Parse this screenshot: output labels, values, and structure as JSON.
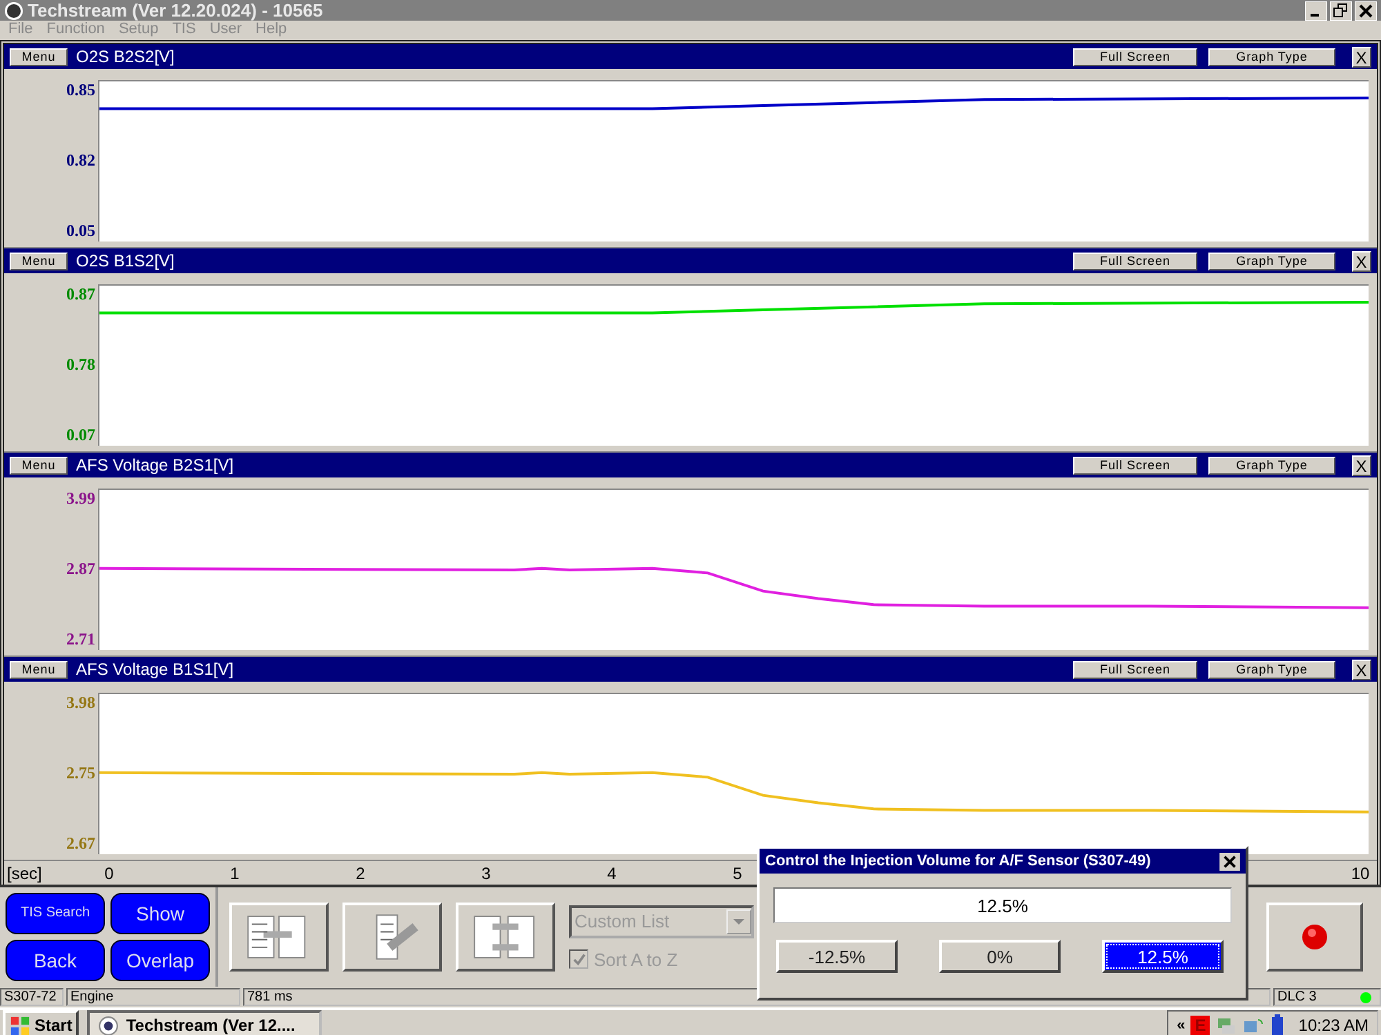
{
  "window": {
    "title": "Techstream (Ver 12.20.024) - 10565"
  },
  "menu": [
    "File",
    "Function",
    "Setup",
    "TIS",
    "User",
    "Help"
  ],
  "graphs": [
    {
      "title": "O2S B2S2[V]",
      "color": "#0000c8",
      "kind": "rising",
      "ylabels": [
        "0.85",
        "0.82",
        "0.05"
      ],
      "buttons": [
        "Menu",
        "Full Screen",
        "Graph Type",
        "X"
      ]
    },
    {
      "title": "O2S B1S2[V]",
      "color": "#00e000",
      "kind": "rising",
      "ylabels": [
        "0.87",
        "0.78",
        "0.07"
      ],
      "buttons": [
        "Menu",
        "Full Screen",
        "Graph Type",
        "X"
      ]
    },
    {
      "title": "AFS Voltage B2S1[V]",
      "color": "#e020e0",
      "kind": "falling",
      "ylabels": [
        "3.99",
        "2.87",
        "2.71"
      ],
      "buttons": [
        "Menu",
        "Full Screen",
        "Graph Type",
        "X"
      ]
    },
    {
      "title": "AFS Voltage B1S1[V]",
      "color": "#f0c020",
      "kind": "falling",
      "ylabels": [
        "3.98",
        "2.75",
        "2.67"
      ],
      "buttons": [
        "Menu",
        "Full Screen",
        "Graph Type",
        "X"
      ]
    }
  ],
  "x_axis": {
    "unit": "[sec]",
    "ticks": [
      "0",
      "1",
      "2",
      "3",
      "4",
      "5",
      "10"
    ]
  },
  "nav_buttons": [
    "TIS Search",
    "Show",
    "Back",
    "Overlap"
  ],
  "custom_list": {
    "value": "Custom List",
    "disabled": true
  },
  "sort_a_to_z": {
    "label": "Sort A to Z",
    "checked": true,
    "disabled": true
  },
  "status_bar": {
    "code": "S307-72",
    "system": "Engine",
    "interval": "781 ms",
    "connection": "DLC 3",
    "connected": true
  },
  "dialog": {
    "title": "Control the Injection Volume for A/F Sensor (S307-49)",
    "value": "12.5%",
    "options": [
      {
        "label": "-12.5%",
        "selected": false
      },
      {
        "label": "0%",
        "selected": false
      },
      {
        "label": "12.5%",
        "selected": true
      }
    ]
  },
  "taskbar": {
    "start": "Start",
    "task": "Techstream (Ver 12....",
    "tray_toggle": "«",
    "tray_badge": "E",
    "clock": "10:23 AM"
  }
}
